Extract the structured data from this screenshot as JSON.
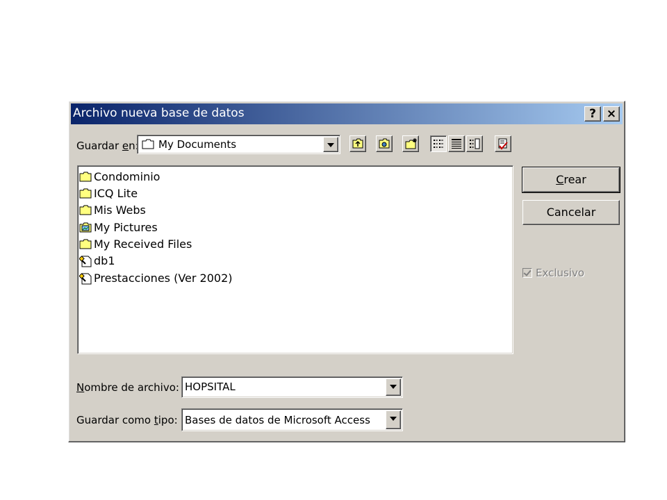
{
  "window": {
    "title": "Archivo nueva base de datos",
    "help_label": "?",
    "close_label": "×"
  },
  "location": {
    "label_pre": "Guardar ",
    "label_ul": "e",
    "label_post": "n:",
    "value": "My Documents"
  },
  "toolbar": [
    "up-one-level-icon",
    "search-web-icon",
    "new-folder-icon",
    "list-view-icon",
    "details-view-icon",
    "properties-view-icon",
    "tools-icon"
  ],
  "files": [
    {
      "name": "Condominio",
      "icon": "folder-icon"
    },
    {
      "name": "ICQ Lite",
      "icon": "folder-icon"
    },
    {
      "name": "Mis Webs",
      "icon": "folder-icon"
    },
    {
      "name": "My Pictures",
      "icon": "pictures-folder-icon"
    },
    {
      "name": "My Received Files",
      "icon": "folder-icon"
    },
    {
      "name": "db1",
      "icon": "access-db-icon"
    },
    {
      "name": "Prestacciones (Ver 2002)",
      "icon": "access-db-icon"
    }
  ],
  "buttons": {
    "create_ul": "C",
    "create_rest": "rear",
    "cancel": "Cancelar"
  },
  "exclusive": {
    "label": "Exclusivo",
    "checked": true,
    "disabled": true
  },
  "filename": {
    "label_ul": "N",
    "label_rest": "ombre de archivo:",
    "value": "HOPSITAL"
  },
  "filetype": {
    "label_pre": "Guardar como ",
    "label_ul": "t",
    "label_post": "ipo:",
    "value": "Bases de datos de Microsoft Access"
  }
}
